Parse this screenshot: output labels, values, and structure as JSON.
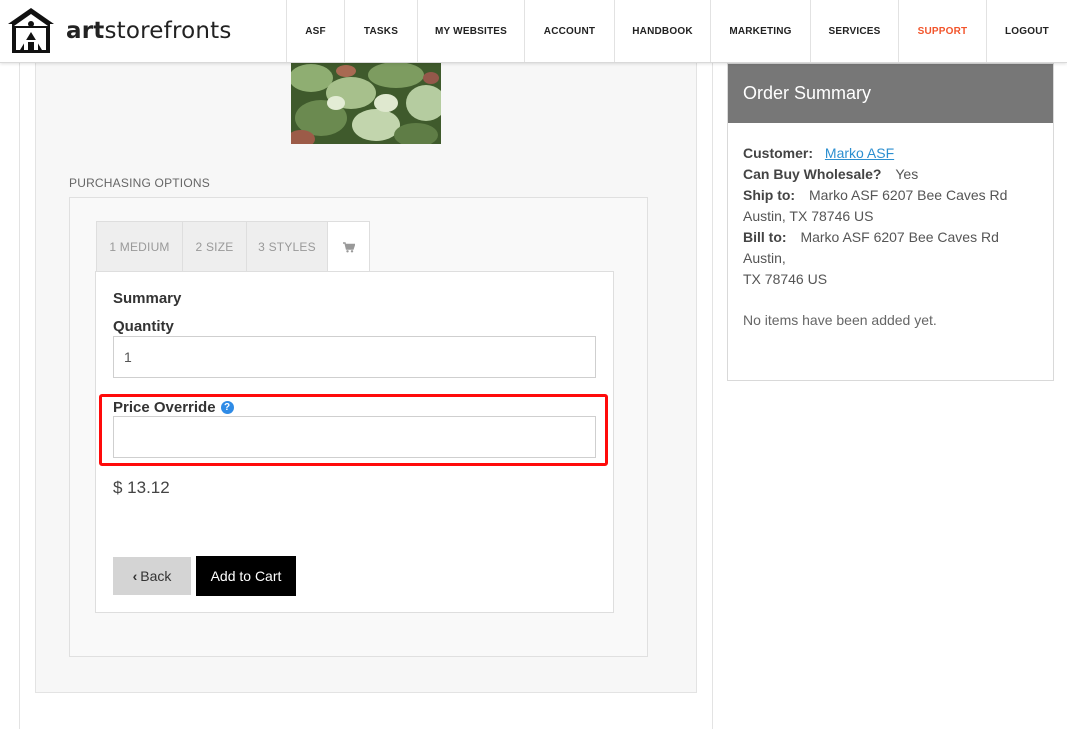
{
  "brand": {
    "prefix": "art",
    "suffix": "storefronts"
  },
  "nav": [
    {
      "label": "ASF",
      "width": 58
    },
    {
      "label": "TASKS",
      "width": 73
    },
    {
      "label": "MY WEBSITES",
      "width": 107
    },
    {
      "label": "ACCOUNT",
      "width": 90
    },
    {
      "label": "HANDBOOK",
      "width": 96
    },
    {
      "label": "MARKETING",
      "width": 100
    },
    {
      "label": "SERVICES",
      "width": 88
    },
    {
      "label": "SUPPORT",
      "width": 88
    },
    {
      "label": "LOGOUT",
      "width": 81
    }
  ],
  "colors": {
    "accent": "#f2552c",
    "link": "#2c8fd0",
    "highlight": "#ff0a0a",
    "order_header": "#777777"
  },
  "purchasing": {
    "section_label": "PURCHASING OPTIONS",
    "tabs": [
      "1 MEDIUM",
      "2 SIZE",
      "3 STYLES"
    ],
    "cart_tab_icon": "cart-icon",
    "summary_title": "Summary",
    "quantity_label": "Quantity",
    "quantity_value": "1",
    "price_override_label": "Price Override",
    "price_override_value": "",
    "price": "$ 13.12",
    "back_label": "Back",
    "add_to_cart_label": "Add to Cart"
  },
  "order_summary": {
    "title": "Order Summary",
    "customer_label": "Customer:",
    "customer_name": "Marko ASF",
    "wholesale_label": "Can Buy Wholesale?",
    "wholesale_value": "Yes",
    "ship_label": "Ship to:",
    "ship_value_line1": "Marko ASF 6207 Bee Caves Rd",
    "ship_value_line2": "Austin, TX 78746 US",
    "bill_label": "Bill to:",
    "bill_value_line1": "Marko ASF 6207 Bee Caves Rd Austin,",
    "bill_value_line2": "TX 78746 US",
    "empty_message": "No items have been added yet."
  }
}
